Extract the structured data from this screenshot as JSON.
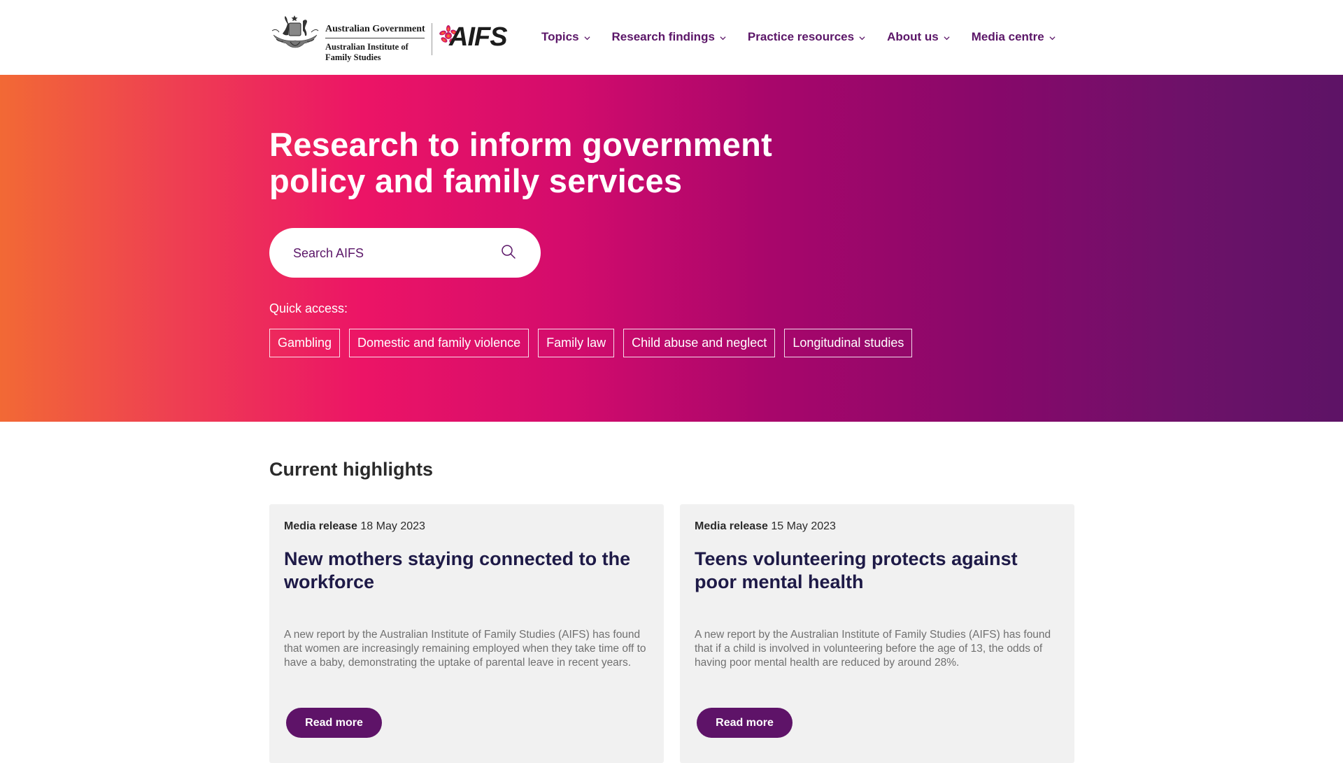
{
  "header": {
    "gov_logo": {
      "line1": "Australian Government",
      "line2": "Australian Institute of",
      "line3": "Family Studies",
      "crest_icon": "coat-of-arms-icon"
    },
    "aifs_logo": {
      "text": "AIFS",
      "star_icon": "aifs-star-icon"
    },
    "nav": [
      {
        "label": "Topics",
        "icon": "chevron-down-icon"
      },
      {
        "label": "Research findings",
        "icon": "chevron-down-icon"
      },
      {
        "label": "Practice resources",
        "icon": "chevron-down-icon"
      },
      {
        "label": "About us",
        "icon": "chevron-down-icon"
      },
      {
        "label": "Media centre",
        "icon": "chevron-down-icon"
      }
    ]
  },
  "hero": {
    "title_line1": "Research to inform government",
    "title_line2": "policy and family services",
    "search": {
      "placeholder": "Search AIFS",
      "value": "",
      "icon": "search-icon"
    },
    "quick_access_label": "Quick access:",
    "quick_access": [
      "Gambling",
      "Domestic and family violence",
      "Family law",
      "Child abuse and neglect",
      "Longitudinal studies"
    ]
  },
  "highlights": {
    "title": "Current highlights",
    "cards": [
      {
        "type": "Media release",
        "date": "18 May 2023",
        "title": "New mothers staying connected to the workforce",
        "summary": "A new report by the Australian Institute of Family Studies (AIFS) has found that women are increasingly remaining employed when they take time off to have a baby, demonstrating the uptake of parental leave in recent years.",
        "button": "Read more"
      },
      {
        "type": "Media release",
        "date": "15 May 2023",
        "title": "Teens volunteering protects against poor mental health",
        "summary": "A new report by the Australian Institute of Family Studies (AIFS) has found that if a child is involved in volunteering before the age of 13, the odds of having poor mental health are reduced by around 28%.",
        "button": "Read more"
      }
    ]
  },
  "colors": {
    "brand_purple": "#5e1368",
    "nav_text": "#5b1668",
    "gradient_start": "#f26935",
    "gradient_pink": "#ec1466",
    "gradient_end": "#5d1366",
    "card_bg": "#f1f1f1",
    "card_title": "#1e1a47"
  }
}
